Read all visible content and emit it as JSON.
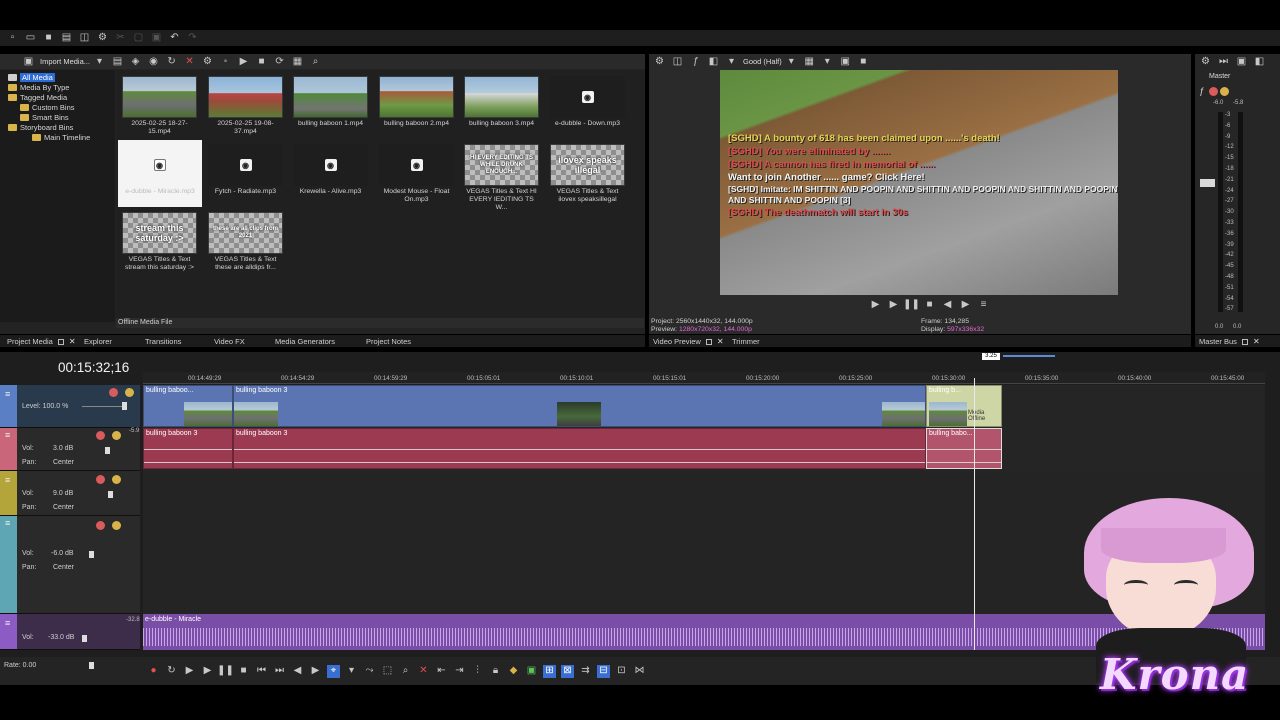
{
  "media_toolbar": {
    "import_label": "Import Media..."
  },
  "media_tree": [
    "All Media",
    "Media By Type",
    "Tagged Media",
    "Custom Bins",
    "Smart Bins",
    "Storyboard Bins",
    "Main Timeline"
  ],
  "media_items": [
    {
      "name": "2025-02-25 18-27-15.mp4",
      "kind": "video"
    },
    {
      "name": "2025-02-25 19-08-37.mp4",
      "kind": "video"
    },
    {
      "name": "bulling baboon 1.mp4",
      "kind": "video"
    },
    {
      "name": "bulling baboon 2.mp4",
      "kind": "video"
    },
    {
      "name": "bulling baboon 3.mp4",
      "kind": "video"
    },
    {
      "name": "e-dubble - Down.mp3",
      "kind": "audio"
    },
    {
      "name": "e-dubble - Miracle.mp3",
      "kind": "audio-selected"
    },
    {
      "name": "Fytch - Radiate.mp3",
      "kind": "audio"
    },
    {
      "name": "Krewella - Alive.mp3",
      "kind": "audio"
    },
    {
      "name": "Modest Mouse - Float On.mp3",
      "kind": "audio"
    },
    {
      "name": "VEGAS Titles & Text HI EVERY IEDITING TS W...",
      "kind": "title",
      "overlay": "HI EVERY EDITING TS WHILE DRUNK ENOUGH..."
    },
    {
      "name": "VEGAS Titles & Text ilovex speaksillegal",
      "kind": "title",
      "overlay": "ilovex speaks illegal"
    },
    {
      "name": "VEGAS Titles & Text stream this saturday :>",
      "kind": "title",
      "overlay": "stream this saturday :>"
    },
    {
      "name": "VEGAS Titles & Text these are alldips fr...",
      "kind": "title",
      "overlay": "these are all clips from 2021"
    }
  ],
  "media_status": "Offline Media File",
  "left_tabs": [
    "Project Media",
    "Explorer",
    "Transitions",
    "Video FX",
    "Media Generators",
    "Project Notes"
  ],
  "preview": {
    "quality": "Good (Half)",
    "chat_lines": [
      "[SGHD] A bounty of 618 has been claimed upon ......'s death!",
      "[SGHD] You were eliminated by .......",
      "[SGHD] A cannon has fired in memorial of ......",
      "Want to join Another ...... game? Click Here!",
      "[SGHD] Imitate: IM SHITTIN AND POOPIN AND SHITTIN AND POOPIN AND SHITTIN AND POOPIN AND SHITTIN AND POOPIN [3]",
      "[SGHD] The deathmatch will start in 30s"
    ],
    "project_label": "Project:",
    "project_value": "2560x1440x32, 144.000p",
    "preview_label": "Preview:",
    "preview_value": "1280x720x32, 144.000p",
    "frame_label": "Frame:",
    "frame_value": "134,285",
    "display_label": "Display:",
    "display_value": "597x336x32",
    "tabs": [
      "Video Preview",
      "Trimmer"
    ]
  },
  "master": {
    "title": "Master",
    "peak_left": "-6.0",
    "peak_right": "-5.8",
    "scale": [
      "3",
      "6",
      "9",
      "12",
      "15",
      "18",
      "21",
      "24",
      "27",
      "30",
      "33",
      "36",
      "39",
      "42",
      "45",
      "48",
      "51",
      "54",
      "57"
    ],
    "bottom_left": "0.0",
    "bottom_right": "0.0",
    "tab": "Master Bus"
  },
  "timeline": {
    "timecode": "00:15:32;16",
    "marker_label": "3.25",
    "ruler": [
      "00:14:49:29",
      "00:14:54:29",
      "00:14:59:29",
      "00:15:05:01",
      "00:15:10:01",
      "00:15:15:01",
      "00:15:20:00",
      "00:15:25:00",
      "00:15:30:00",
      "00:15:35:00",
      "00:15:40:00",
      "00:15:45:00"
    ],
    "video_track": {
      "level_label": "Level: 100.0 %",
      "clips": [
        "bulling baboo...",
        "bulling baboon 3",
        "bulling b..."
      ],
      "fx_text": "Media Offline"
    },
    "audio_tracks": [
      {
        "vol": "3.0 dB",
        "pan": "Center",
        "clips": [
          "bulling baboon 3",
          "bulling baboon 3",
          "bulling babo..."
        ]
      },
      {
        "vol": "9.0 dB",
        "pan": "Center"
      },
      {
        "vol": "-6.0 dB",
        "pan": "Center"
      },
      {
        "vol": "-33.0 dB",
        "clip": "e-dubble - Miracle"
      }
    ],
    "vol_label": "Vol:",
    "pan_label": "Pan:",
    "meter_top": "-5.9",
    "meter_top2": "-32.8",
    "rate": "Rate: 0.00"
  },
  "overlay_logo": "Krona"
}
